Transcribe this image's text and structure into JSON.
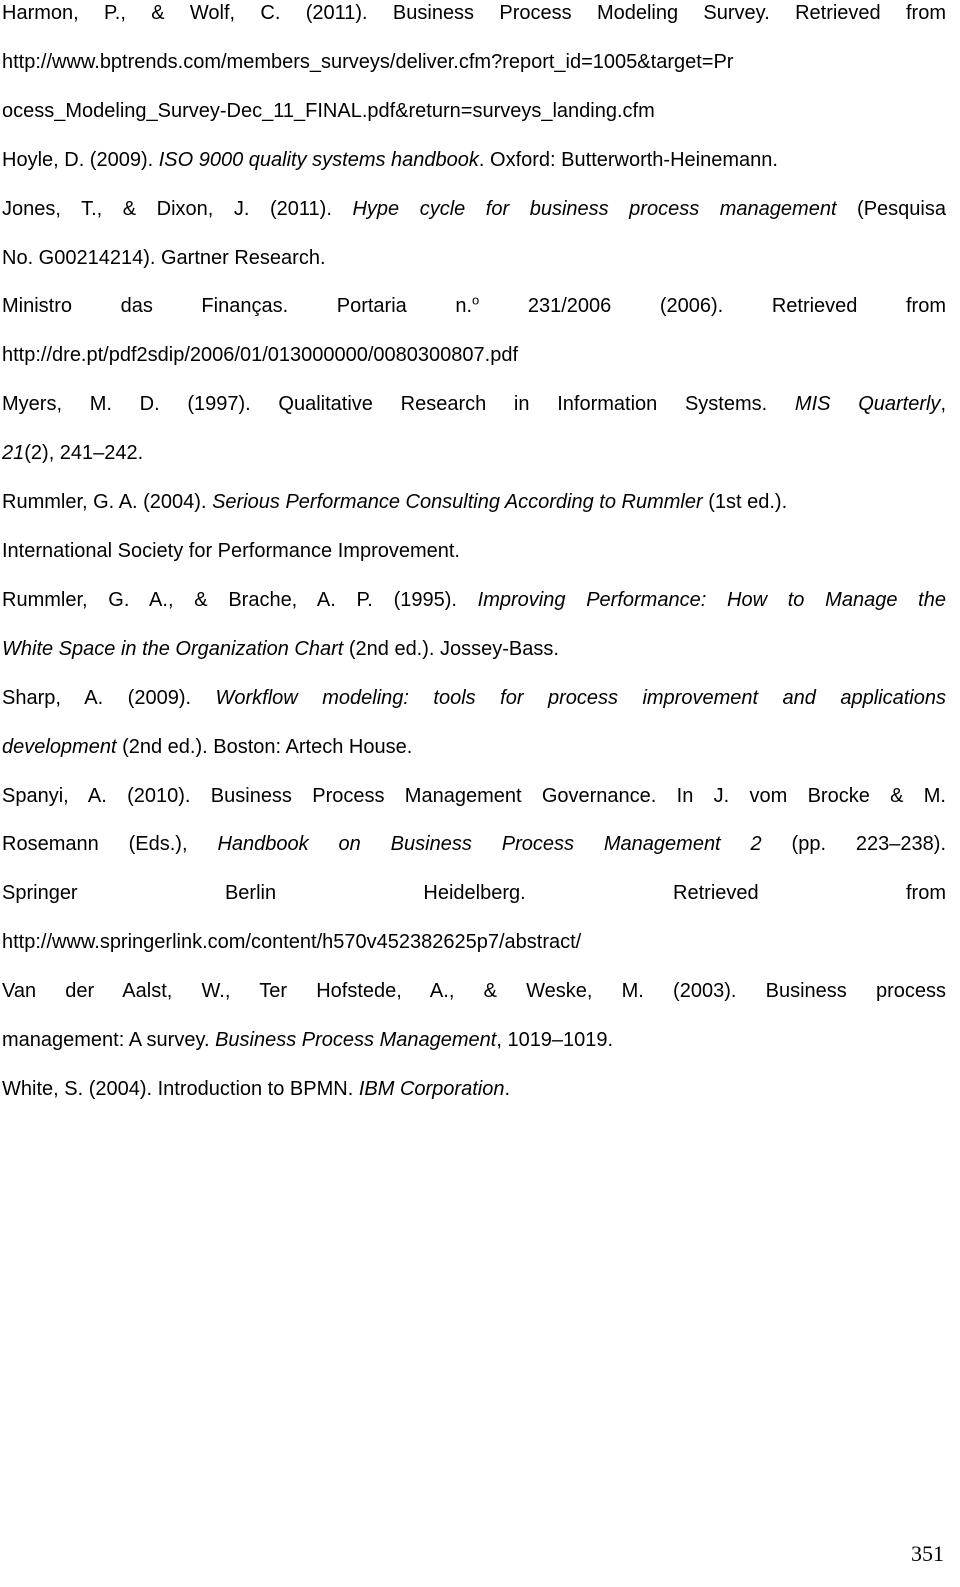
{
  "references": [
    {
      "lines": [
        {
          "justify": true,
          "segments": [
            {
              "text": "Harmon, P., & Wolf, C. (2011). Business Process Modeling Survey. Retrieved from"
            }
          ]
        },
        {
          "justify": true,
          "segments": [
            {
              "text": "http://www.bptrends.com/members_surveys/deliver.cfm?report_id=1005&target=Pr"
            }
          ]
        },
        {
          "justify": false,
          "segments": [
            {
              "text": "ocess_Modeling_Survey-Dec_11_FINAL.pdf&return=surveys_landing.cfm"
            }
          ]
        }
      ]
    },
    {
      "lines": [
        {
          "justify": false,
          "segments": [
            {
              "text": "Hoyle, D. (2009). "
            },
            {
              "text": "ISO 9000 quality systems handbook",
              "italic": true
            },
            {
              "text": ". Oxford: Butterworth-Heinemann."
            }
          ]
        }
      ]
    },
    {
      "lines": [
        {
          "justify": true,
          "segments": [
            {
              "text": "Jones, T., & Dixon, J. (2011). "
            },
            {
              "text": "Hype cycle for business process management",
              "italic": true
            },
            {
              "text": " (Pesquisa"
            }
          ]
        },
        {
          "justify": false,
          "segments": [
            {
              "text": "No. G00214214). Gartner Research."
            }
          ]
        }
      ]
    },
    {
      "lines": [
        {
          "justify": true,
          "segments": [
            {
              "text": "Ministro das Finanças. Portaria n."
            },
            {
              "text": "o",
              "sup": true
            },
            {
              "text": " 231/2006 (2006). Retrieved from"
            }
          ]
        },
        {
          "justify": false,
          "segments": [
            {
              "text": "http://dre.pt/pdf2sdip/2006/01/013000000/0080300807.pdf"
            }
          ]
        }
      ]
    },
    {
      "lines": [
        {
          "justify": true,
          "segments": [
            {
              "text": "Myers, M. D. (1997). Qualitative Research in Information Systems. "
            },
            {
              "text": "MIS Quarterly",
              "italic": true
            },
            {
              "text": ","
            }
          ]
        },
        {
          "justify": false,
          "segments": [
            {
              "text": "21",
              "italic": true
            },
            {
              "text": "(2), 241–242."
            }
          ]
        }
      ]
    },
    {
      "lines": [
        {
          "justify": false,
          "segments": [
            {
              "text": "Rummler, G. A. (2004). "
            },
            {
              "text": "Serious Performance Consulting According to Rummler",
              "italic": true
            },
            {
              "text": " (1st ed.)."
            }
          ]
        },
        {
          "justify": false,
          "segments": [
            {
              "text": "International Society for Performance Improvement."
            }
          ]
        }
      ]
    },
    {
      "lines": [
        {
          "justify": true,
          "segments": [
            {
              "text": "Rummler, G. A., & Brache, A. P. (1995). "
            },
            {
              "text": "Improving Performance: How to Manage the",
              "italic": true
            }
          ]
        },
        {
          "justify": false,
          "segments": [
            {
              "text": "White Space in the Organization Chart",
              "italic": true
            },
            {
              "text": " (2nd ed.). Jossey-Bass."
            }
          ]
        }
      ]
    },
    {
      "lines": [
        {
          "justify": true,
          "segments": [
            {
              "text": "Sharp, A. (2009). "
            },
            {
              "text": "Workflow modeling: tools for process improvement and applications",
              "italic": true
            }
          ]
        },
        {
          "justify": false,
          "segments": [
            {
              "text": "development",
              "italic": true
            },
            {
              "text": " (2nd ed.). Boston: Artech House."
            }
          ]
        }
      ]
    },
    {
      "lines": [
        {
          "justify": true,
          "segments": [
            {
              "text": "Spanyi, A. (2010). Business Process Management Governance. In J. vom Brocke & M."
            }
          ]
        },
        {
          "justify": true,
          "segments": [
            {
              "text": "Rosemann (Eds.), "
            },
            {
              "text": "Handbook on Business Process Management 2",
              "italic": true
            },
            {
              "text": " (pp. 223–238)."
            }
          ]
        },
        {
          "justify": true,
          "segments": [
            {
              "text": "Springer Berlin Heidelberg. Retrieved from"
            }
          ]
        },
        {
          "justify": false,
          "segments": [
            {
              "text": "http://www.springerlink.com/content/h570v452382625p7/abstract/"
            }
          ]
        }
      ]
    },
    {
      "lines": [
        {
          "justify": true,
          "segments": [
            {
              "text": "Van der Aalst, W., Ter Hofstede, A., & Weske, M. (2003). Business process"
            }
          ]
        },
        {
          "justify": false,
          "segments": [
            {
              "text": "management: A survey. "
            },
            {
              "text": "Business Process Management",
              "italic": true
            },
            {
              "text": ", 1019–1019."
            }
          ]
        }
      ]
    },
    {
      "lines": [
        {
          "justify": false,
          "segments": [
            {
              "text": "White, S. (2004). Introduction to BPMN. "
            },
            {
              "text": "IBM Corporation",
              "italic": true
            },
            {
              "text": "."
            }
          ]
        }
      ]
    }
  ],
  "page_number": "351"
}
